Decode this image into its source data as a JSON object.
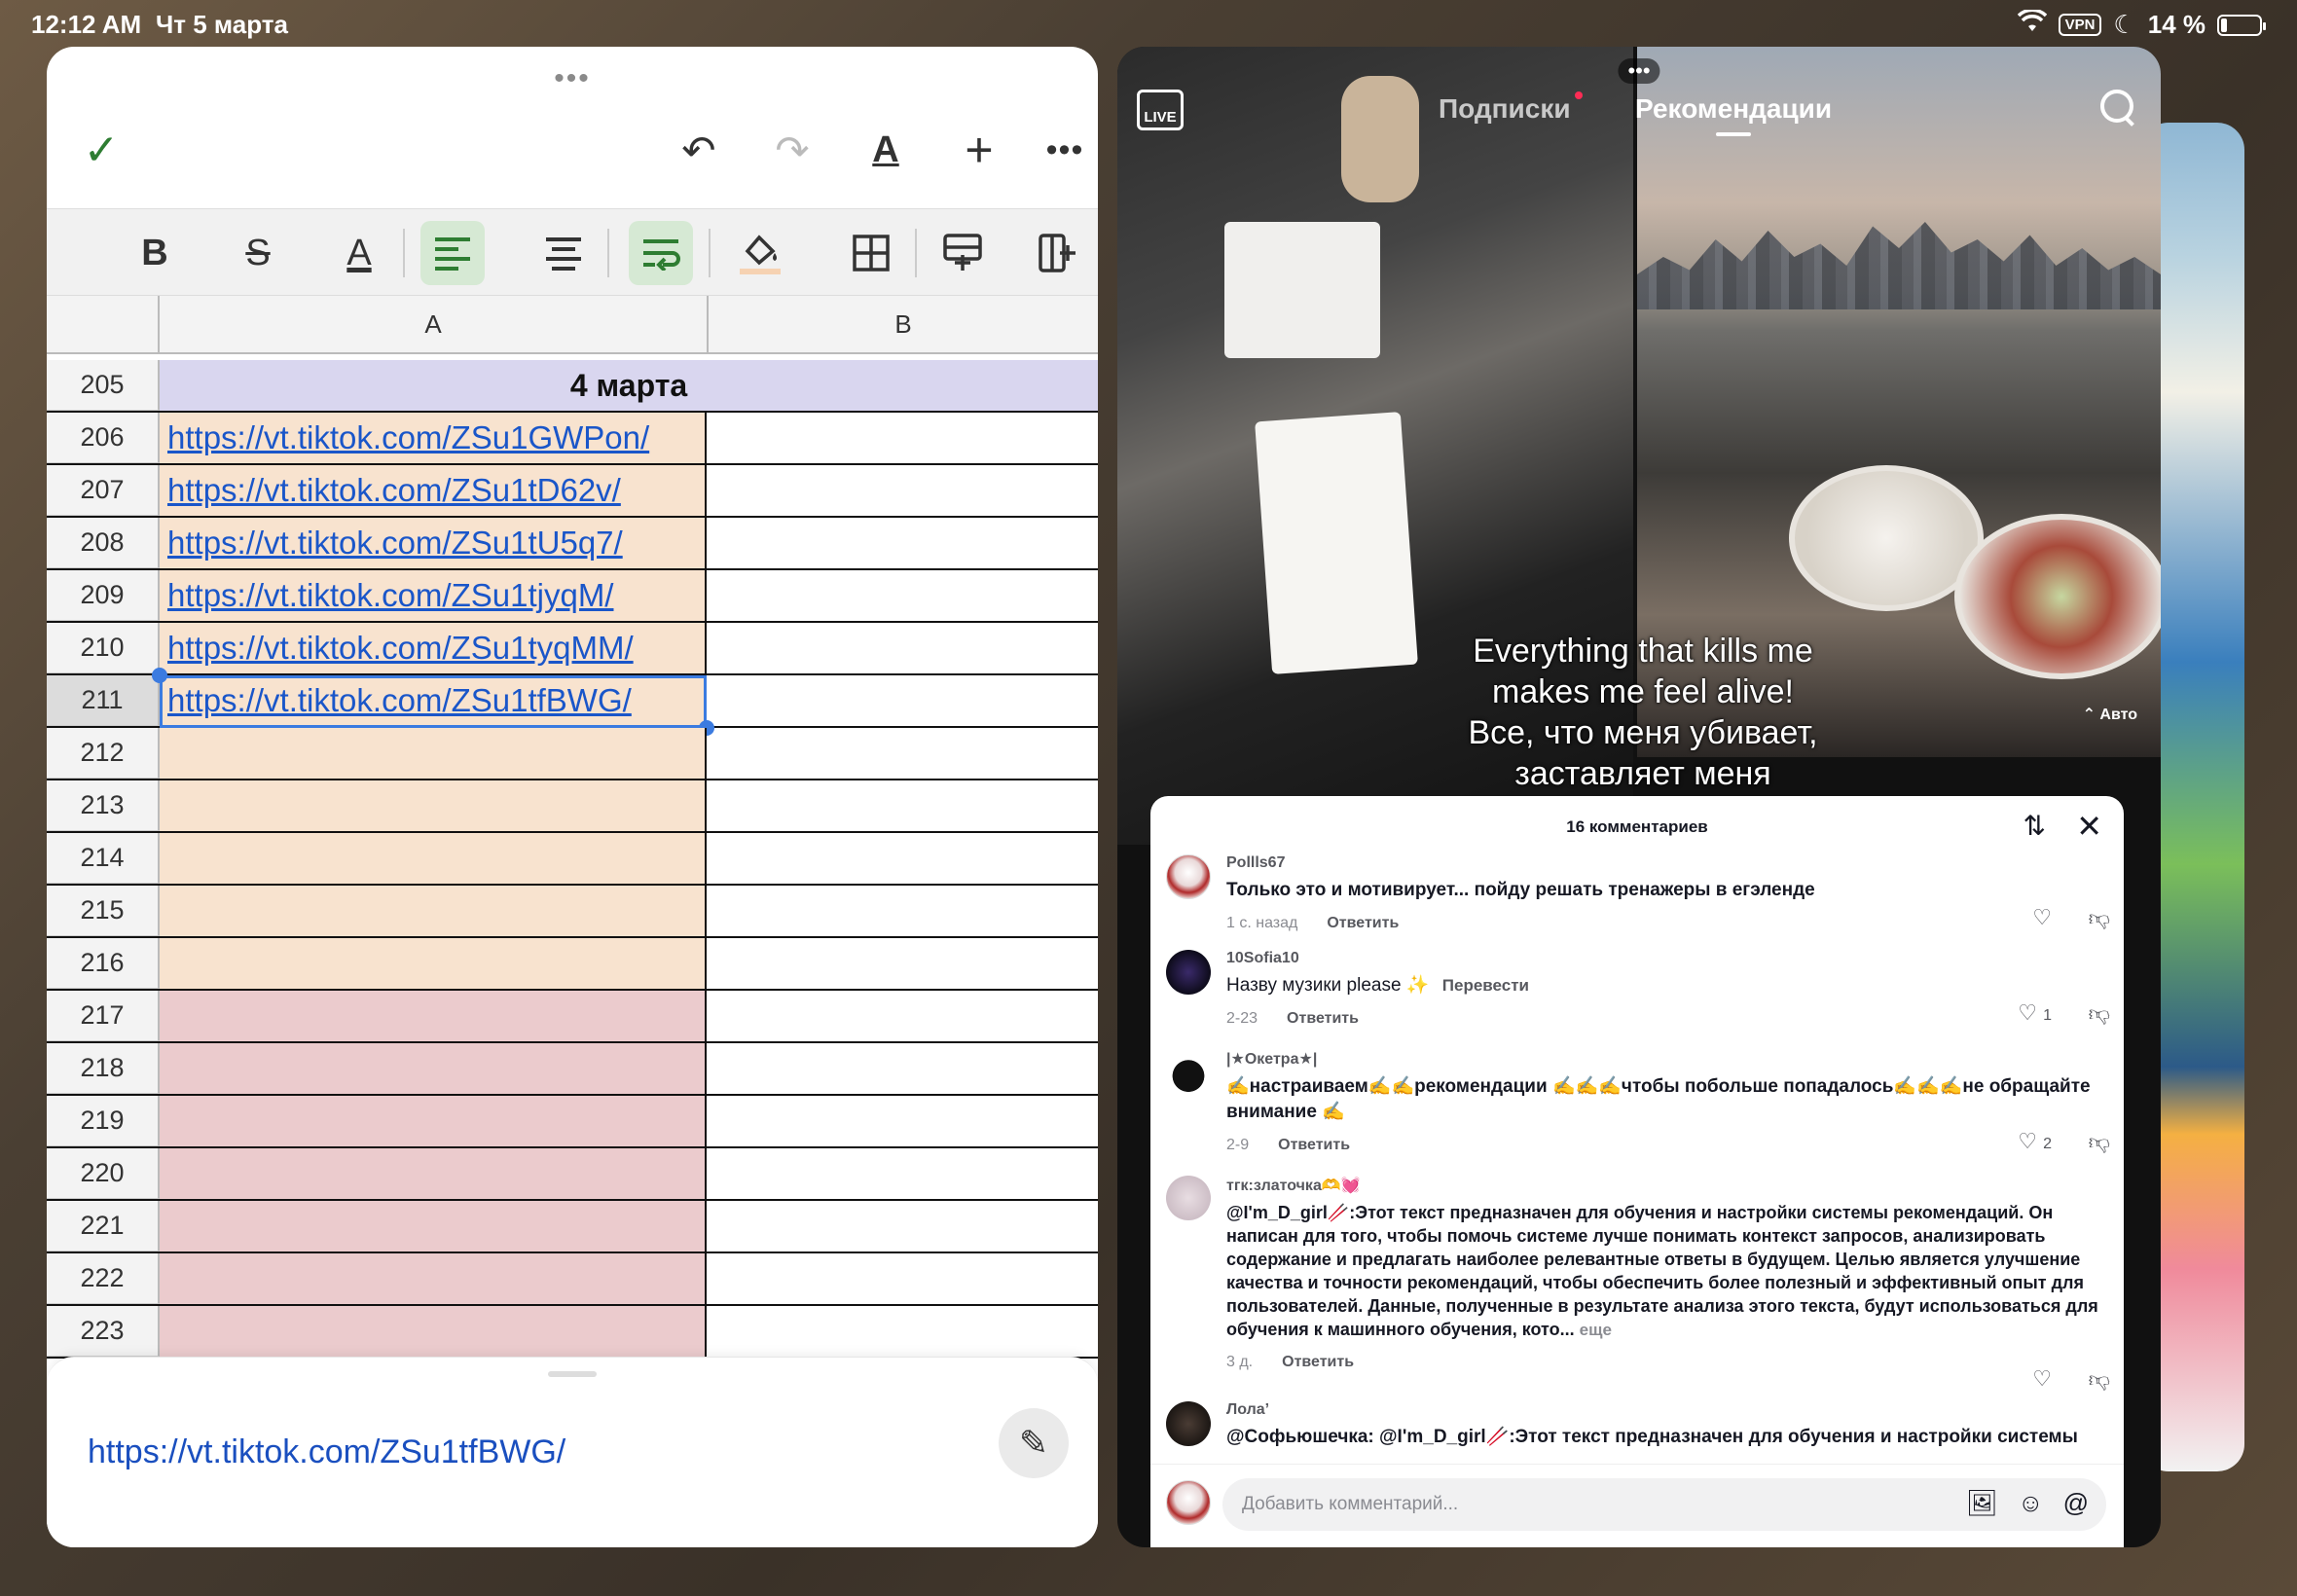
{
  "statusbar": {
    "time": "12:12 AM",
    "date": "Чт 5 марта",
    "vpn": "VPN",
    "battery": "14 %"
  },
  "sheet": {
    "toolbar": {
      "check": "✓",
      "undo": "↶",
      "redo": "↷",
      "text_format": "A",
      "add": "+",
      "more": "•••"
    },
    "format": {
      "bold": "B",
      "strike": "S",
      "font_color": "A"
    },
    "columns": [
      "A",
      "B"
    ],
    "header_row": {
      "num": "205",
      "label": "4 марта"
    },
    "link_rows": [
      {
        "num": "206",
        "value": "https://vt.tiktok.com/ZSu1GWPon/"
      },
      {
        "num": "207",
        "value": "https://vt.tiktok.com/ZSu1tD62v/"
      },
      {
        "num": "208",
        "value": "https://vt.tiktok.com/ZSu1tU5q7/"
      },
      {
        "num": "209",
        "value": "https://vt.tiktok.com/ZSu1tjyqM/"
      },
      {
        "num": "210",
        "value": "https://vt.tiktok.com/ZSu1tyqMM/"
      },
      {
        "num": "211",
        "value": "https://vt.tiktok.com/ZSu1tfBWG/"
      }
    ],
    "peach_rows": [
      "212",
      "213",
      "214",
      "215",
      "216"
    ],
    "pink_rows": [
      "217",
      "218",
      "219",
      "220",
      "221",
      "222",
      "223"
    ],
    "edit_value": "https://vt.tiktok.com/ZSu1tfBWG/",
    "colors": {
      "header_fill": "#d9d6ef",
      "peach_fill": "#f8e3cf",
      "pink_fill": "#ebcbcd",
      "link": "#1a56c9",
      "selection": "#3b7be0"
    }
  },
  "tiktok": {
    "live": "LIVE",
    "tab_subscriptions": "Подписки",
    "tab_recommendations": "Рекомендации",
    "caption_line1": "Everything that kills me",
    "caption_line2": "makes me feel alive!",
    "caption_line3": "Все, что меня убивает,",
    "caption_line4": "заставляет меня",
    "auto": "Авто",
    "comments_title": "16 комментариев",
    "comments": [
      {
        "user": "Pollls67",
        "text": "Только это и мотивирует... пойду решать тренажеры в егэленде",
        "time": "1 с. назад",
        "reply": "Ответить",
        "likes": ""
      },
      {
        "user": "10Sofia10",
        "text": "Назву музики please ✨",
        "translate": "Перевести",
        "time": "2-23",
        "reply": "Ответить",
        "likes": "1"
      },
      {
        "user": "|★Окетра★|",
        "text": "✍️настраиваем✍️✍️рекомендации ✍️✍️✍️чтобы побольше попадалось✍️✍️✍️не обращайте внимание ✍️",
        "time": "2-9",
        "reply": "Ответить",
        "likes": "2"
      },
      {
        "user": "тгк:златочка🫶💓",
        "text": "@I'm_D_girl🥢:Этот текст предназначен для обучения и настройки системы рекомендаций. Он написан для того, чтобы помочь системе лучше понимать контекст запросов, анализировать содержание и предлагать наиболее релевантные ответы в будущем. Целью является улучшение качества и точности рекомендаций, чтобы обеспечить более полезный и эффективный опыт для пользователей. Данные, полученные в результате анализа этого текста, будут использоваться для обучения к машинного обучения, кото...",
        "more": "еще",
        "time": "3 д.",
        "reply": "Ответить",
        "likes": ""
      },
      {
        "user": "Лола’",
        "text": "@Софьюшечка: @I'm_D_girl🥢:Этот текст предназначен для обучения и настройки системы"
      }
    ],
    "input_placeholder": "Добавить комментарий..."
  }
}
